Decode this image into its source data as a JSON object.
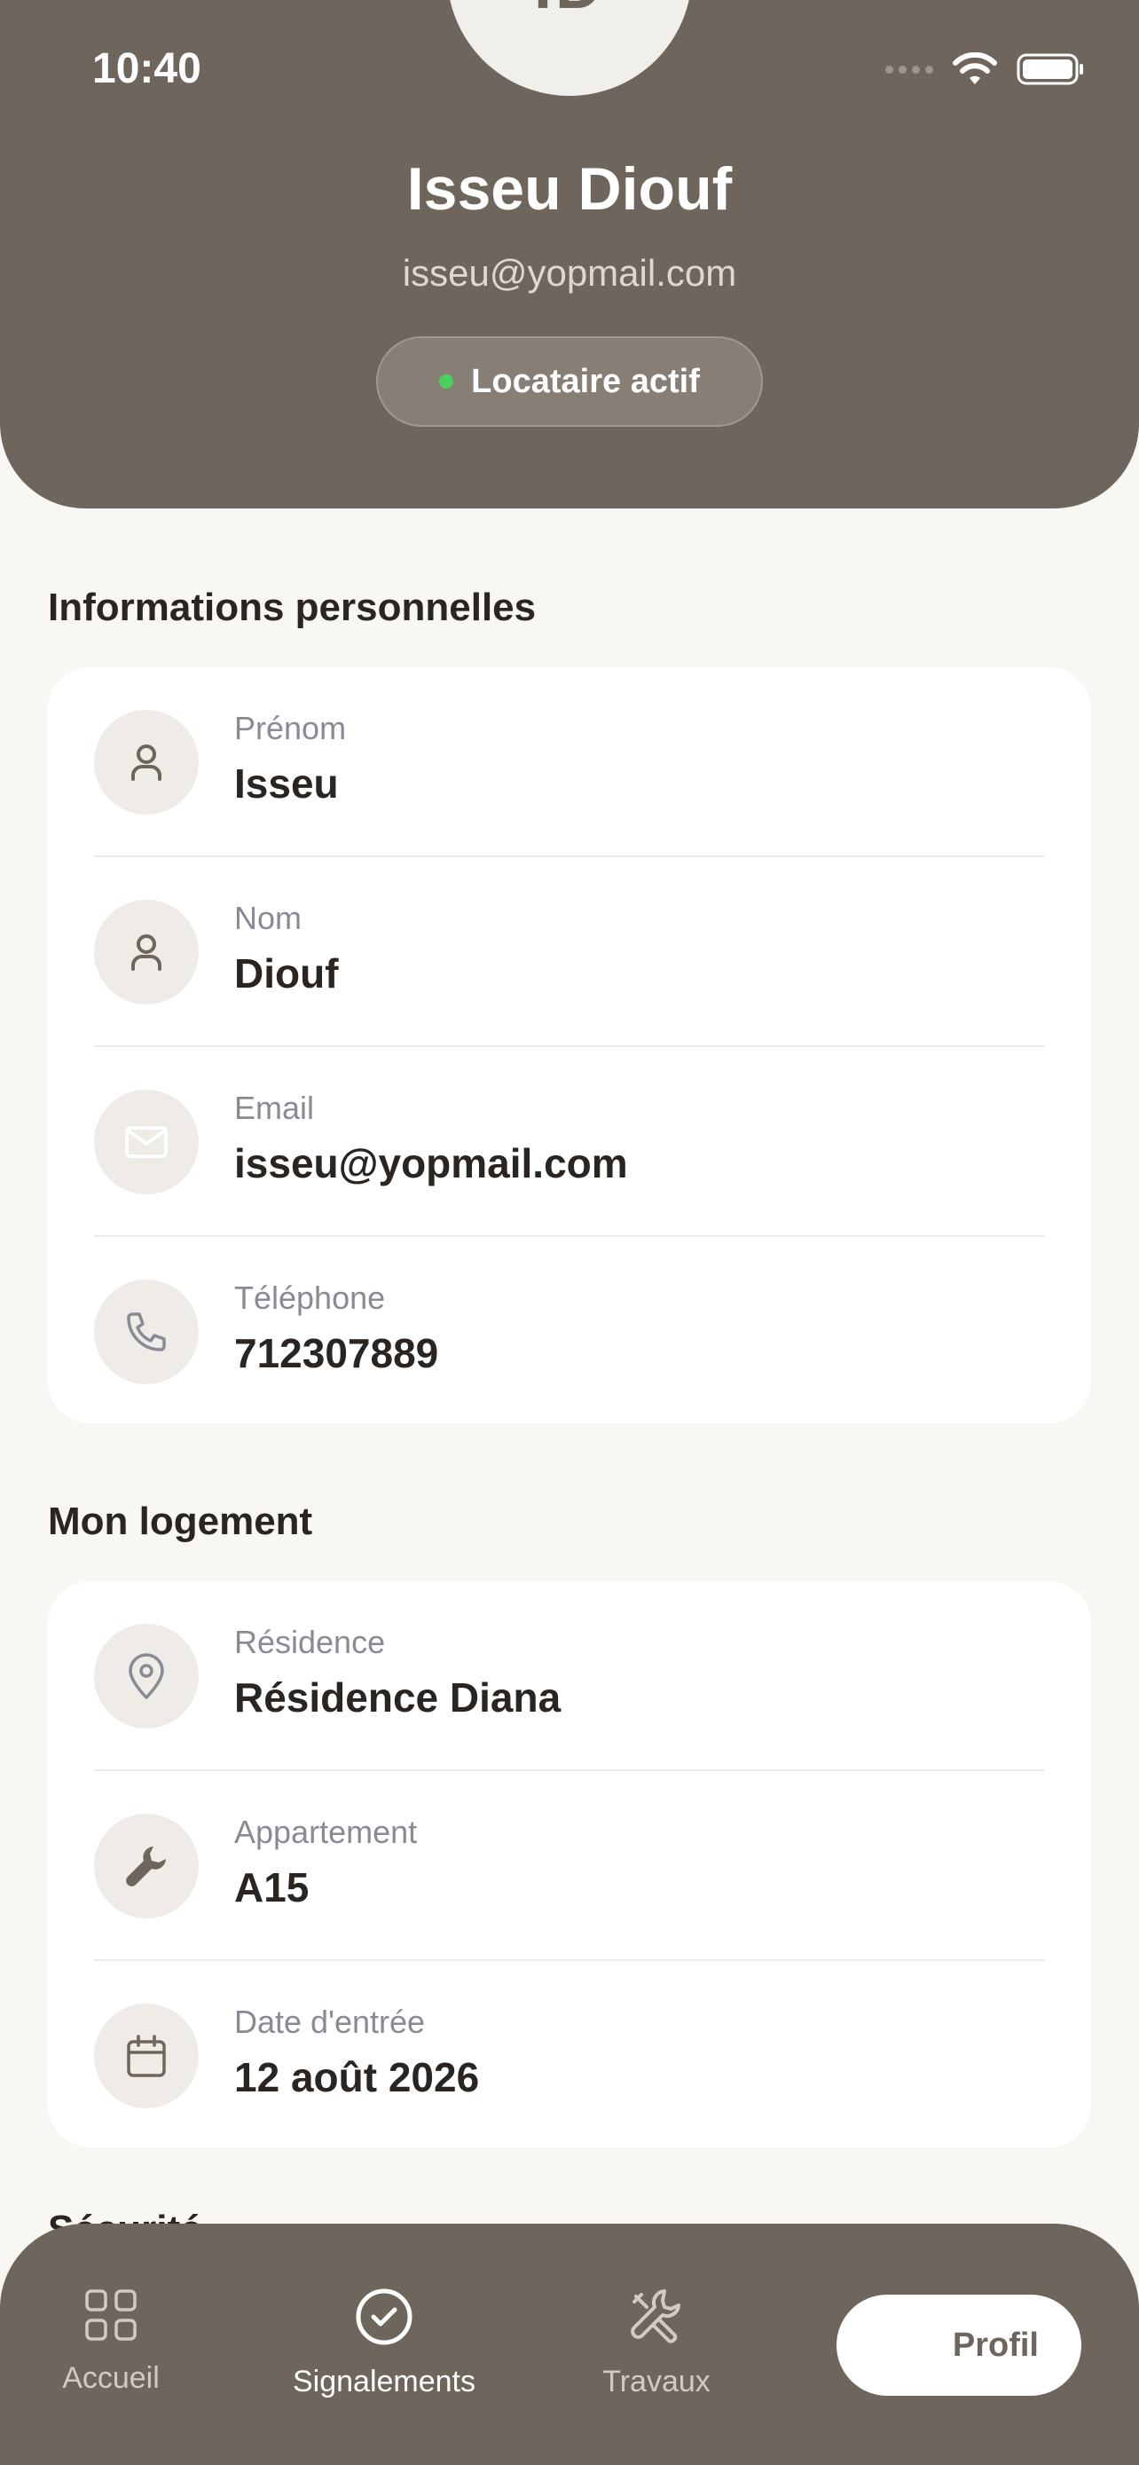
{
  "status_bar": {
    "time": "10:40"
  },
  "profile": {
    "initials": "ID",
    "name": "Isseu Diouf",
    "email": "isseu@yopmail.com",
    "status": "Locataire actif"
  },
  "personal": {
    "title": "Informations personnelles",
    "rows": [
      {
        "label": "Prénom",
        "value": "Isseu",
        "icon": "user-icon"
      },
      {
        "label": "Nom",
        "value": "Diouf",
        "icon": "user-icon"
      },
      {
        "label": "Email",
        "value": "isseu@yopmail.com",
        "icon": "mail-icon"
      },
      {
        "label": "Téléphone",
        "value": "712307889",
        "icon": "phone-icon"
      }
    ]
  },
  "housing": {
    "title": "Mon logement",
    "rows": [
      {
        "label": "Résidence",
        "value": "Résidence Diana",
        "icon": "location-pin-icon"
      },
      {
        "label": "Appartement",
        "value": "A15",
        "icon": "wrench-icon"
      },
      {
        "label": "Date d'entrée",
        "value": "12 août 2026",
        "icon": "calendar-icon"
      }
    ]
  },
  "next_section": {
    "title": "Sécurité"
  },
  "nav": {
    "items": [
      {
        "label": "Accueil",
        "icon": "grid-icon"
      },
      {
        "label": "Signalements",
        "icon": "check-circle-icon"
      },
      {
        "label": "Travaux",
        "icon": "tools-icon"
      },
      {
        "label": "Profil",
        "icon": "user-icon"
      }
    ]
  },
  "colors": {
    "header": "#6e655c",
    "background": "#f8f7f3",
    "status_dot": "#4cd15f",
    "card": "#ffffff"
  }
}
